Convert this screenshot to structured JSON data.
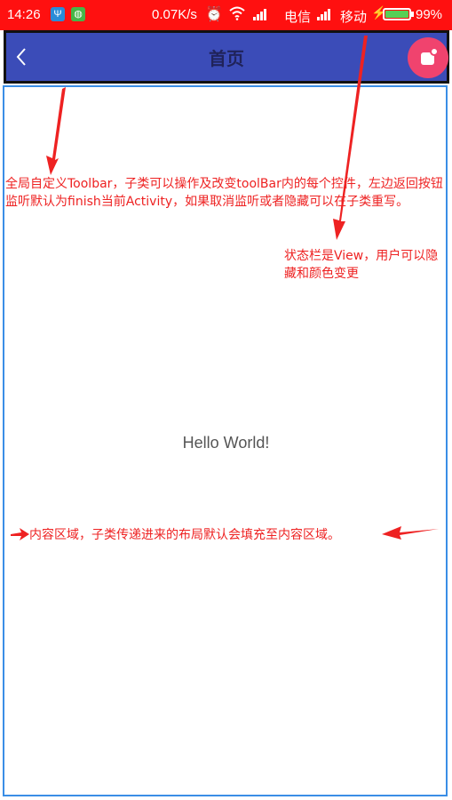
{
  "status_bar": {
    "time": "14:26",
    "net_speed": "0.07K/s",
    "carrier1": "电信",
    "carrier2": "移动",
    "battery_percent": "99%",
    "battery_level": 0.99,
    "background_color": "#ff1010",
    "icons": [
      "usb-icon",
      "android-debug-icon",
      "alarm-icon",
      "wifi-icon",
      "signal-icon",
      "charging-icon",
      "battery-icon"
    ]
  },
  "toolbar": {
    "title": "首页",
    "back_icon": "chevron-left-icon",
    "action_icon": "notification-badge-icon",
    "background_color": "#3b4cb8"
  },
  "content": {
    "hello_text": "Hello World!"
  },
  "annotations": {
    "toolbar_note": "全局自定义Toolbar，子类可以操作及改变toolBar内的每个控件，左边返回按钮监听默认为finish当前Activity，如果取消监听或者隐藏可以在子类重写。",
    "statusbar_note": "状态栏是View，用户可以隐藏和颜色变更",
    "content_note": "内容区域，子类传递进来的布局默认会填充至内容区域。",
    "color": "#ee2222"
  }
}
